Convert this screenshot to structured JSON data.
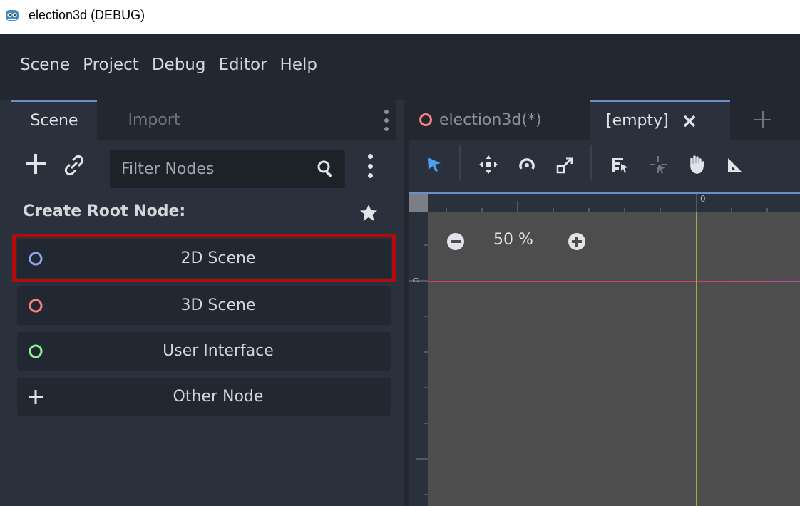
{
  "window": {
    "title": "election3d (DEBUG)"
  },
  "menu": {
    "items": [
      "Scene",
      "Project",
      "Debug",
      "Editor",
      "Help"
    ]
  },
  "scene_dock": {
    "tabs": [
      "Scene",
      "Import"
    ],
    "filter_placeholder": "Filter Nodes",
    "create_root_label": "Create Root Node:",
    "root_nodes": [
      {
        "label": "2D Scene",
        "icon": "2d-node-icon",
        "color": "#8da5f3"
      },
      {
        "label": "3D Scene",
        "icon": "3d-node-icon",
        "color": "#fc7f7f"
      },
      {
        "label": "User Interface",
        "icon": "control-node-icon",
        "color": "#8eef97"
      },
      {
        "label": "Other Node",
        "icon": "add-icon",
        "color": "#e0e3e8"
      }
    ],
    "highlighted_item": "2D Scene",
    "highlight_color": "#b30a0a"
  },
  "scene_tabs": {
    "tabs": [
      {
        "label": "election3d(*)",
        "icon": "3d-node-icon",
        "active": false
      },
      {
        "label": "[empty]",
        "icon": "close-icon",
        "active": true
      }
    ]
  },
  "viewport": {
    "zoom": "50 %",
    "ruler_zero": "0"
  },
  "colors": {
    "editor_bg": "#232830",
    "panel_bg": "#2b313c",
    "accent": "#6c8ec7",
    "viewport_bg": "#4d4d4d"
  }
}
